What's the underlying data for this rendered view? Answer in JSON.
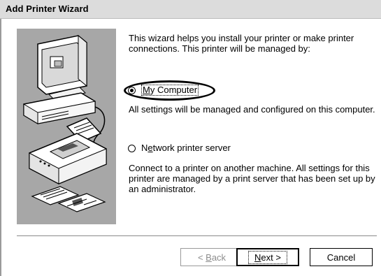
{
  "window": {
    "title": "Add Printer Wizard"
  },
  "illustration": {
    "icons": [
      "computer-monitor-icon",
      "printer-icon",
      "printed-pages-icon"
    ],
    "background_color": "#a7a7a7"
  },
  "intro_text": "This wizard helps you install your printer or make printer connections.  This printer will be managed by:",
  "options": [
    {
      "label_prefix": "",
      "label_accel": "M",
      "label_rest": "y Computer",
      "selected": true,
      "description": "All settings will be managed and configured on this computer."
    },
    {
      "label_prefix": "N",
      "label_accel": "e",
      "label_rest": "twork printer server",
      "selected": false,
      "description": "Connect to a printer on another machine.  All settings for this printer are managed by a print server that has been set up by an administrator."
    }
  ],
  "buttons": {
    "back": {
      "prefix": "< ",
      "accel": "B",
      "rest": "ack",
      "enabled": false
    },
    "next": {
      "prefix": "",
      "accel": "N",
      "rest": "ext >",
      "enabled": true
    },
    "cancel": {
      "label": "Cancel",
      "enabled": true
    }
  },
  "colors": {
    "title_bar": "#dcdcdc",
    "highlight_ellipse": "#000000",
    "disabled_text": "#8c8c8c"
  }
}
